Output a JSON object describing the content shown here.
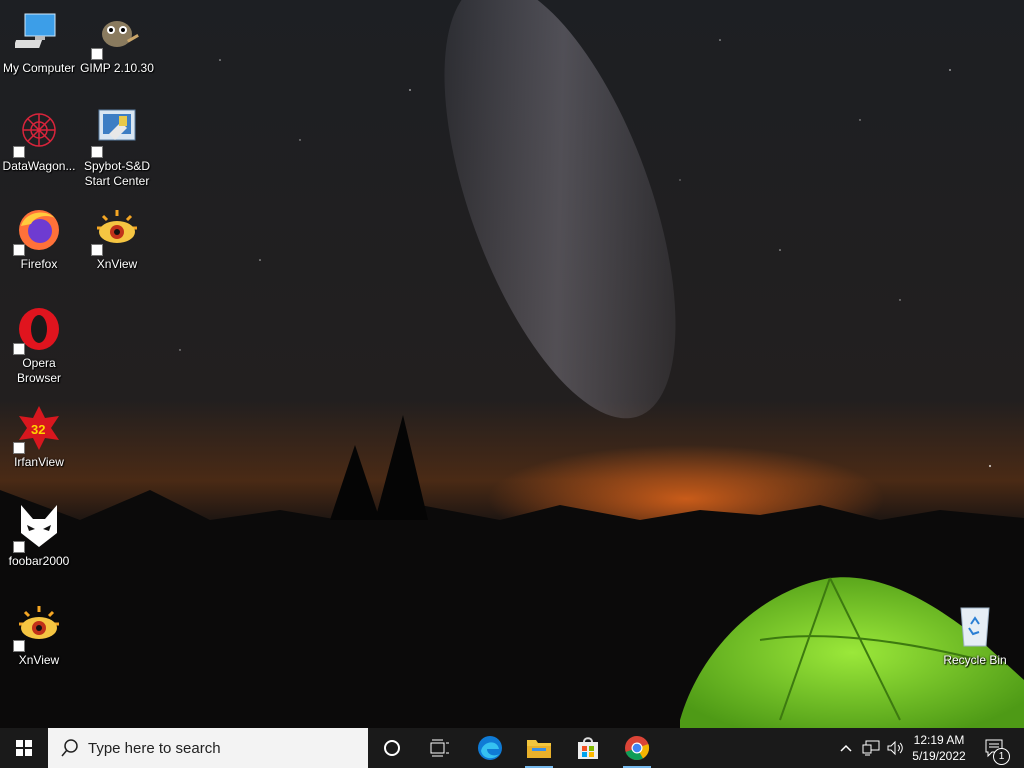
{
  "desktop": {
    "icons": [
      {
        "name": "my-computer",
        "label": "My Computer",
        "icon": "computer-icon"
      },
      {
        "name": "gimp",
        "label": "GIMP 2.10.30",
        "icon": "gimp-icon"
      },
      {
        "name": "datawagon",
        "label": "DataWagon...",
        "icon": "datawagon-icon"
      },
      {
        "name": "spybot",
        "label": "Spybot-S&D Start Center",
        "icon": "spybot-icon"
      },
      {
        "name": "firefox",
        "label": "Firefox",
        "icon": "firefox-icon"
      },
      {
        "name": "xnview-top",
        "label": "XnView",
        "icon": "xnview-icon"
      },
      {
        "name": "opera",
        "label": "Opera Browser",
        "icon": "opera-icon"
      },
      {
        "name": "irfanview",
        "label": "IrfanView",
        "icon": "irfanview-icon"
      },
      {
        "name": "foobar2000",
        "label": "foobar2000",
        "icon": "foobar-icon"
      },
      {
        "name": "xnview-bottom",
        "label": "XnView",
        "icon": "xnview-icon"
      },
      {
        "name": "recycle-bin",
        "label": "Recycle Bin",
        "icon": "recycle-bin-icon"
      }
    ]
  },
  "taskbar": {
    "search_placeholder": "Type here to search",
    "apps": [
      "edge-icon",
      "file-explorer-icon",
      "store-icon",
      "chrome-icon"
    ],
    "clock": {
      "time": "12:19 AM",
      "date": "5/19/2022"
    },
    "notifications_count": "1",
    "accent": "#76b9ed"
  }
}
